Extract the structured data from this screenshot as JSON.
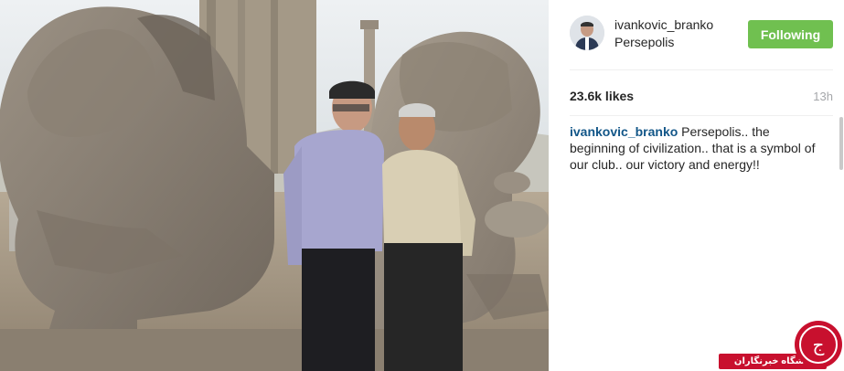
{
  "post": {
    "photo_alt": "",
    "username": "ivankovic_branko",
    "location": "Persepolis",
    "follow_label": "Following",
    "likes": "23.6k likes",
    "time_ago": "13h",
    "caption_user": "ivankovic_branko",
    "caption_text": " Persepolis.. the beginning of civilization.. that is a symbol of our club.. our victory and energy!!"
  },
  "watermark": {
    "text": "باشگاه خبرنگاران",
    "logo_glyph": "ج"
  },
  "icons": {
    "avatar": "user-avatar"
  },
  "colors": {
    "follow_button": "#70c050",
    "username_link": "#125688",
    "muted": "#a5a7aa",
    "watermark_red": "#c8102e"
  }
}
